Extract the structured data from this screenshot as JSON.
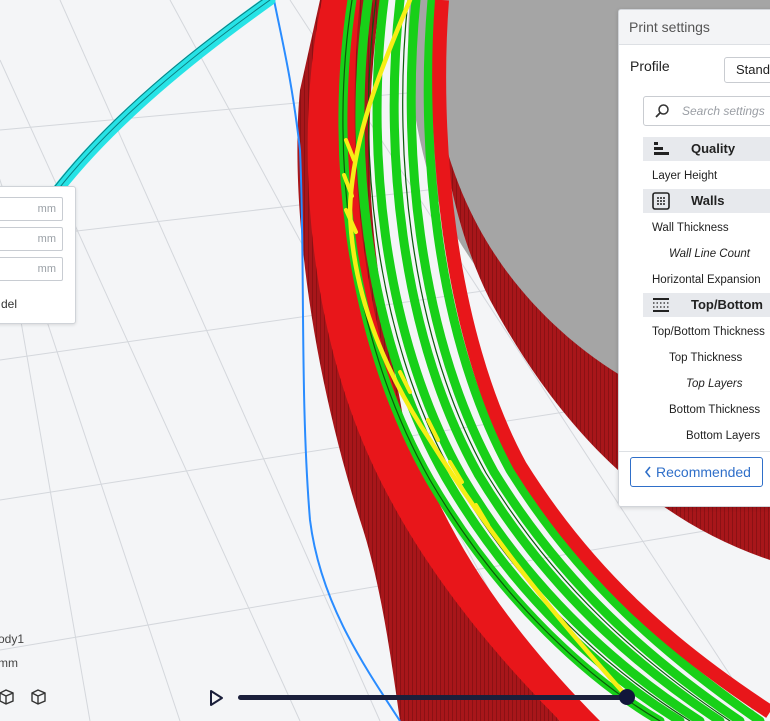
{
  "left_panel": {
    "fields": [
      {
        "unit": "mm"
      },
      {
        "unit": "mm"
      },
      {
        "unit": "mm"
      }
    ],
    "label": "del"
  },
  "object": {
    "name": "ody1",
    "dims": "mm"
  },
  "settings": {
    "title": "Print settings",
    "profile_label": "Profile",
    "profile_value": "Standa",
    "search_placeholder": "Search settings",
    "categories": [
      {
        "label": "Quality",
        "icon": "quality-icon",
        "items": [
          {
            "label": "Layer Height",
            "indent": 0,
            "italic": false
          }
        ]
      },
      {
        "label": "Walls",
        "icon": "walls-icon",
        "items": [
          {
            "label": "Wall Thickness",
            "indent": 0,
            "italic": false
          },
          {
            "label": "Wall Line Count",
            "indent": 1,
            "italic": true
          },
          {
            "label": "Horizontal Expansion",
            "indent": 0,
            "italic": false
          }
        ]
      },
      {
        "label": "Top/Bottom",
        "icon": "top-bottom-icon",
        "items": [
          {
            "label": "Top/Bottom Thickness",
            "indent": 0,
            "italic": false
          },
          {
            "label": "Top Thickness",
            "indent": 1,
            "italic": false
          },
          {
            "label": "Top Layers",
            "indent": 2,
            "italic": true
          },
          {
            "label": "Bottom Thickness",
            "indent": 1,
            "italic": false
          },
          {
            "label": "Bottom Layers",
            "indent": 2,
            "italic": false
          }
        ]
      }
    ],
    "recommended_label": "Recommended"
  },
  "colors": {
    "wall_outer": "#e8161a",
    "wall_inner": "#18d018",
    "seam": "#f6ee16",
    "travel": "#2a8cff",
    "skirt": "#27e3e6",
    "accent": "#2f6fc9"
  },
  "icons": [
    "search-icon",
    "chevron-left-icon",
    "play-icon",
    "cube-icon"
  ]
}
